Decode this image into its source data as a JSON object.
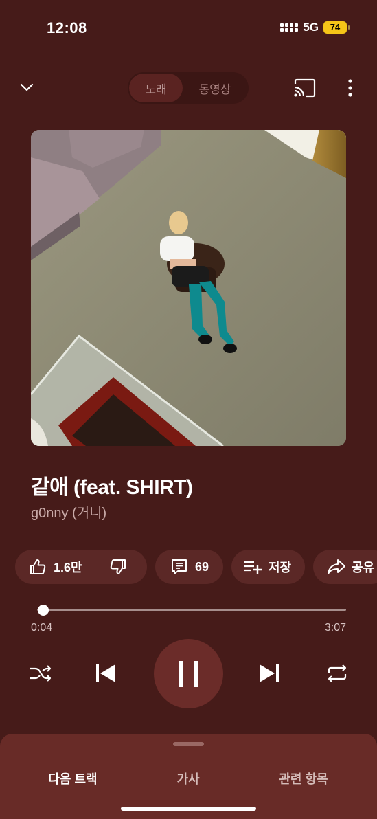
{
  "status": {
    "time": "12:08",
    "network": "5G",
    "battery": "74"
  },
  "header": {
    "segments": [
      "노래",
      "동영상"
    ],
    "active_segment": "노래"
  },
  "track": {
    "title": "같애 (feat. SHIRT)",
    "artist": "g0nny (거니)",
    "elapsed": "0:04",
    "duration": "3:07",
    "progress": 0.021
  },
  "actions": {
    "likes": "1.6만",
    "comments": "69",
    "save_label": "저장",
    "share_label": "공유"
  },
  "sheet": {
    "tabs": [
      "다음 트랙",
      "가사",
      "관련 항목"
    ],
    "active_tab": "다음 트랙"
  },
  "colors": {
    "background": "#461b19",
    "chip": "#5b2826",
    "play_button": "#6b2c29",
    "sheet": "#682b27"
  },
  "icons": [
    "chevron-down-icon",
    "cast-icon",
    "more-vert-icon",
    "thumb-up-icon",
    "thumb-down-icon",
    "comment-icon",
    "playlist-add-icon",
    "share-icon",
    "shuffle-icon",
    "skip-previous-icon",
    "pause-icon",
    "skip-next-icon",
    "repeat-icon"
  ]
}
